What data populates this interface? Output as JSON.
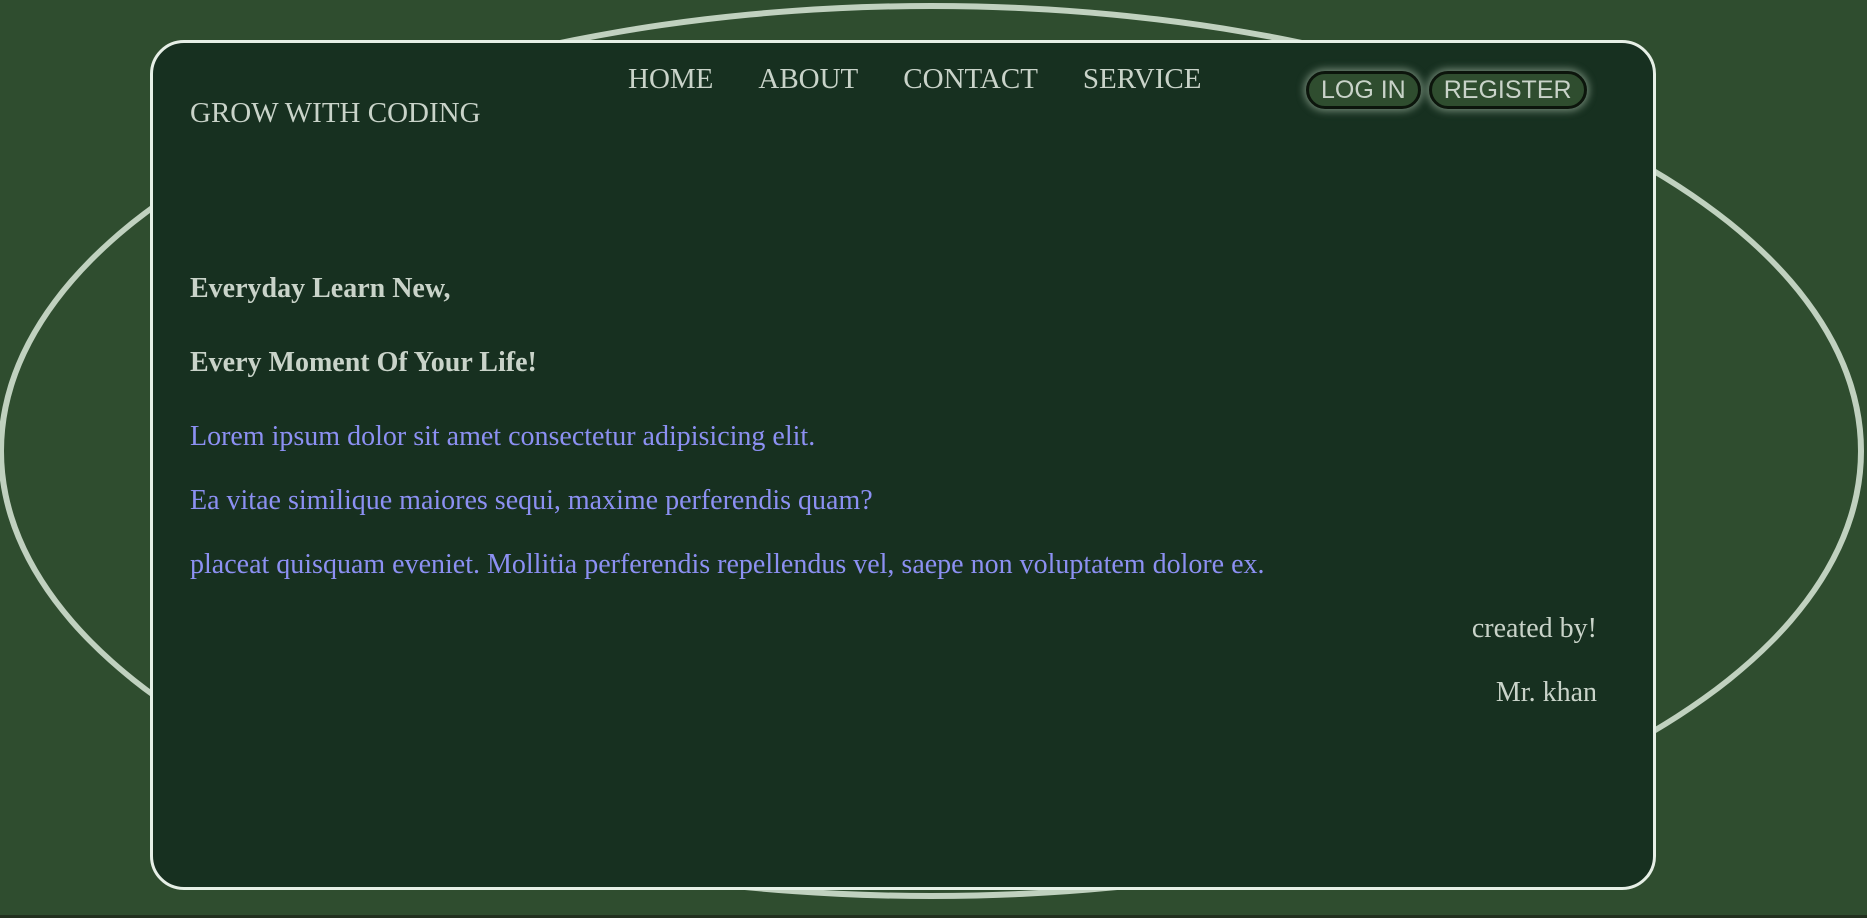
{
  "header": {
    "brand": "GROW WITH CODING",
    "nav": [
      "HOME",
      "ABOUT",
      "CONTACT",
      "SERVICE"
    ],
    "login_label": "LOG IN",
    "register_label": "REGISTER"
  },
  "hero": {
    "line1": "Everyday Learn New,",
    "line2": "Every Moment Of Your Life!",
    "paragraphs": [
      "Lorem ipsum dolor sit amet consectetur adipisicing elit.",
      "Ea vitae similique maiores sequi, maxime perferendis quam?",
      "placeat quisquam eveniet. Mollitia perferendis repellendus vel, saepe non voluptatem dolore ex."
    ]
  },
  "credit": {
    "line1": "created by!",
    "line2": "Mr. khan"
  },
  "colors": {
    "background": "#2f4d2f",
    "card": "#173020",
    "ellipse": "#c0d1bf",
    "text": "#c9d3c9",
    "lorem": "#8c90f2"
  }
}
